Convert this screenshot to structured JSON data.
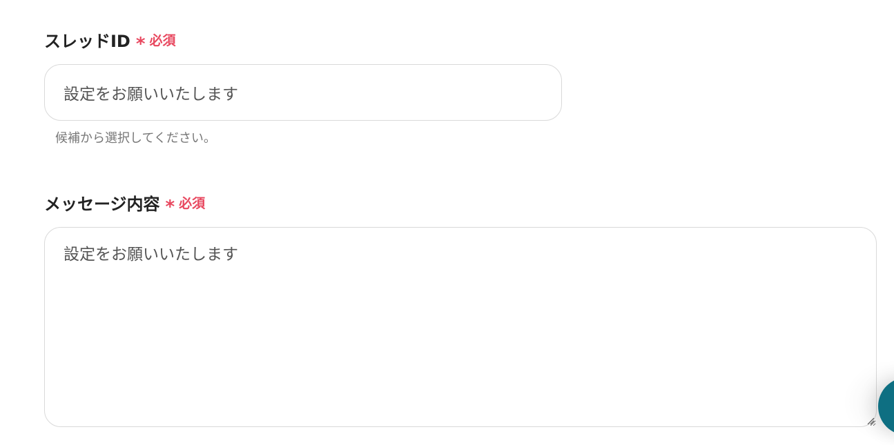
{
  "thread_field": {
    "label": "スレッドID",
    "required_star": "*",
    "required_text": "必須",
    "value": "設定をお願いいたします",
    "help": "候補から選択してください。"
  },
  "message_field": {
    "label": "メッセージ内容",
    "required_star": "*",
    "required_text": "必須",
    "value": "設定をお願いいたします"
  },
  "colors": {
    "required": "#e8485f",
    "fab": "#0e6f82",
    "border": "#d9d9d9"
  },
  "icons": {
    "resize": "resize-handle-icon",
    "fab": "chat-button"
  }
}
